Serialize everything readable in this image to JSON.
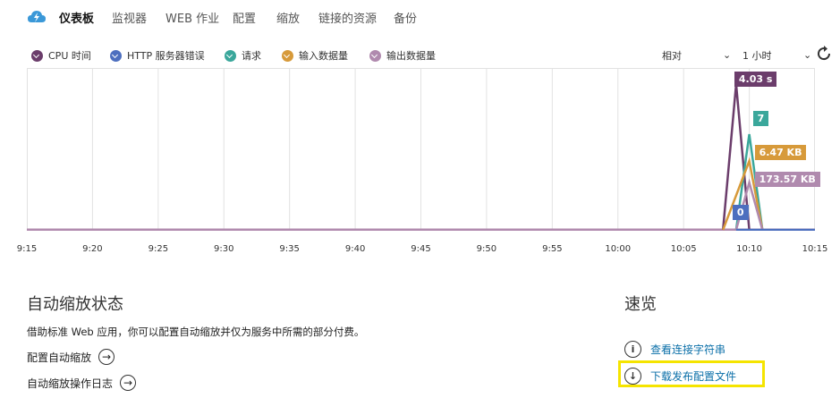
{
  "nav": {
    "tabs": [
      "仪表板",
      "监视器",
      "WEB 作业",
      "配置",
      "缩放",
      "链接的资源",
      "备份"
    ],
    "active": 0
  },
  "legend": {
    "items": [
      {
        "label": "CPU 时间",
        "color": "#6b3d6b"
      },
      {
        "label": "HTTP 服务器错误",
        "color": "#4d6fbf"
      },
      {
        "label": "请求",
        "color": "#3aa79b"
      },
      {
        "label": "输入数据量",
        "color": "#d79a3a"
      },
      {
        "label": "输出数据量",
        "color": "#b08aae"
      }
    ]
  },
  "controls": {
    "mode": "相对",
    "range": "1 小时"
  },
  "chart_data": {
    "type": "line",
    "x": [
      "9:15",
      "9:20",
      "9:25",
      "9:30",
      "9:35",
      "9:40",
      "9:45",
      "9:50",
      "9:55",
      "10:00",
      "10:05",
      "10:10",
      "10:15"
    ],
    "series": [
      {
        "name": "CPU 时间",
        "color": "#6b3d6b",
        "peak_label": "4.03 s",
        "points": [
          [
            "10:08",
            0
          ],
          [
            "10:09",
            4.03
          ],
          [
            "10:10",
            0
          ]
        ]
      },
      {
        "name": "请求",
        "color": "#3aa79b",
        "peak_label": "7",
        "points": [
          [
            "10:09",
            0
          ],
          [
            "10:10",
            7
          ],
          [
            "10:11",
            0
          ]
        ]
      },
      {
        "name": "输入数据量",
        "color": "#d79a3a",
        "peak_label": "6.47 KB",
        "points": [
          [
            "10:08",
            0
          ],
          [
            "10:10",
            6.47
          ],
          [
            "10:11",
            0
          ]
        ]
      },
      {
        "name": "输出数据量",
        "color": "#b08aae",
        "peak_label": "173.57 KB",
        "points": [
          [
            "10:09",
            0
          ],
          [
            "10:10",
            173.57
          ],
          [
            "10:11",
            0
          ]
        ]
      },
      {
        "name": "HTTP 服务器错误",
        "color": "#4d6fbf",
        "peak_label": "0",
        "points": [
          [
            "10:09",
            0
          ],
          [
            "10:15",
            0
          ]
        ]
      }
    ]
  },
  "autoscale": {
    "title": "自动缩放状态",
    "desc": "借助标准 Web 应用，你可以配置自动缩放并仅为服务中所需的部分付费。",
    "configure": "配置自动缩放",
    "log": "自动缩放操作日志"
  },
  "quick": {
    "title": "速览",
    "conn": "查看连接字符串",
    "download": "下载发布配置文件"
  }
}
